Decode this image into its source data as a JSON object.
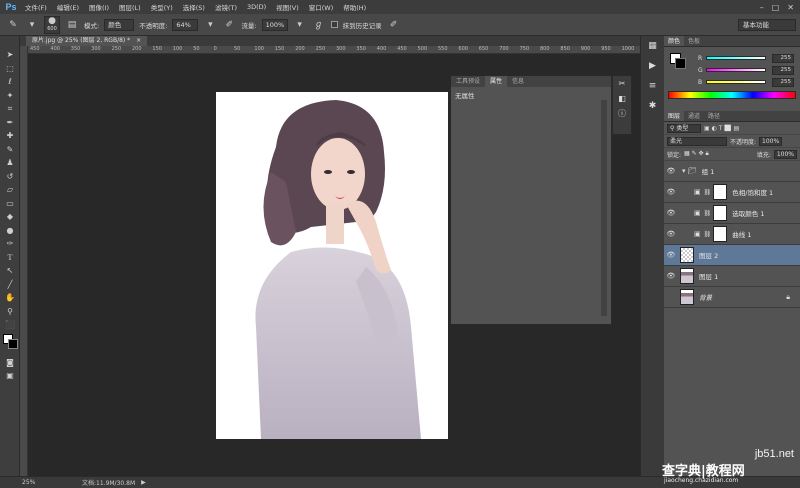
{
  "app": {
    "logo": "Ps"
  },
  "menubar": {
    "items": [
      "文件(F)",
      "编辑(E)",
      "图像(I)",
      "图层(L)",
      "类型(Y)",
      "选择(S)",
      "滤镜(T)",
      "3D(D)",
      "视图(V)",
      "窗口(W)",
      "帮助(H)"
    ]
  },
  "options": {
    "brush_size": "600",
    "mode_label": "模式:",
    "mode_value": "颜色",
    "opacity_label": "不透明度:",
    "opacity_value": "64%",
    "flow_label": "流量:",
    "flow_value": "100%",
    "history_label": "抹到历史记录",
    "workspace": "基本功能"
  },
  "document": {
    "tab_title": "原片.jpg @ 25% (图层 2, RGB/8) *",
    "ruler_ticks": [
      "450",
      "400",
      "350",
      "300",
      "250",
      "200",
      "150",
      "100",
      "50",
      "0",
      "50",
      "100",
      "150",
      "200",
      "250",
      "300",
      "350",
      "400",
      "450",
      "500",
      "550",
      "600",
      "650",
      "700",
      "750",
      "800",
      "850",
      "900",
      "950",
      "1000"
    ]
  },
  "props_panel": {
    "tabs": [
      "工具预设",
      "属性",
      "信息"
    ],
    "active_tab": 1,
    "body_text": "无属性"
  },
  "color_panel": {
    "tabs": [
      "颜色",
      "色板"
    ],
    "channels": [
      {
        "name": "R",
        "value": "255",
        "gradient": "#00ffff,#ffffff"
      },
      {
        "name": "G",
        "value": "255",
        "gradient": "#ff00ff,#ffffff"
      },
      {
        "name": "B",
        "value": "255",
        "gradient": "#ffff00,#ffffff"
      }
    ]
  },
  "layers_panel": {
    "tabs": [
      "图层",
      "通道",
      "路径"
    ],
    "filter_label": "类型",
    "blend_mode": "柔光",
    "opacity_label": "不透明度:",
    "opacity_value": "100%",
    "lock_label": "锁定:",
    "fill_label": "填充:",
    "fill_value": "100%",
    "layers": [
      {
        "name": "组 1",
        "kind": "group",
        "selected": false
      },
      {
        "name": "色相/饱和度 1",
        "kind": "adjustment",
        "selected": false
      },
      {
        "name": "选取颜色 1",
        "kind": "adjustment",
        "selected": false
      },
      {
        "name": "曲线 1",
        "kind": "adjustment",
        "selected": false
      },
      {
        "name": "图层 2",
        "kind": "pixel",
        "selected": true
      },
      {
        "name": "图层 1",
        "kind": "photo",
        "selected": false
      },
      {
        "name": "背景",
        "kind": "background",
        "selected": false
      }
    ]
  },
  "status": {
    "zoom": "25%",
    "doc_info": "文档:11.9M/30.8M"
  },
  "watermark": {
    "site": "jb51.net",
    "line1": "查字典",
    "line2": "教程网",
    "url": "jiaocheng.chazidian.com"
  }
}
